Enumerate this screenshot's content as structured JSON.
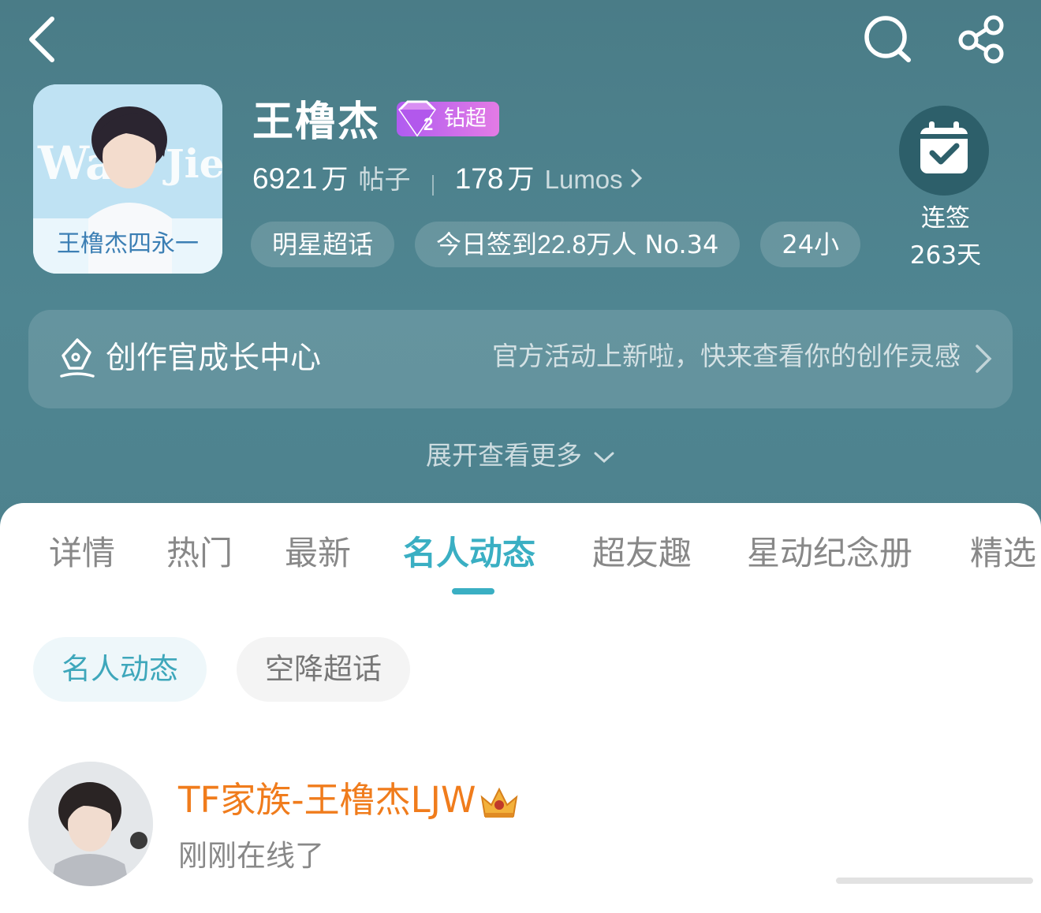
{
  "topic": {
    "name": "王橹杰",
    "badge_label": "钻超",
    "badge_level": "2",
    "avatar_text": "王橹杰四永一",
    "posts_num": "6921",
    "posts_unit": "万",
    "posts_label": "帖子",
    "fans_num": "178",
    "fans_unit": "万",
    "fans_label": "Lumos"
  },
  "tags": [
    {
      "label": "明星超话"
    },
    {
      "label_prefix": "今日签到",
      "label_num": "22.8",
      "label_suffix": "万人 No.34"
    },
    {
      "label": "24小"
    }
  ],
  "checkin": {
    "label": "连签",
    "days": "263天"
  },
  "creator_center": {
    "title": "创作官成长中心",
    "subtitle": "官方活动上新啦，快来查看你的创作灵感"
  },
  "expand_label": "展开查看更多",
  "tabs": [
    "详情",
    "热门",
    "最新",
    "名人动态",
    "超友趣",
    "星动纪念册",
    "精选"
  ],
  "active_tab": "名人动态",
  "subtabs": [
    "名人动态",
    "空降超话"
  ],
  "celebrity": {
    "name": "TF家族-王橹杰LJW",
    "status": "刚刚在线了"
  },
  "colors": {
    "header_bg": "#4d828e",
    "accent": "#3aafc3",
    "celebrity_name": "#f07c1c",
    "badge": "#c36af0"
  },
  "icons": [
    "back-icon",
    "search-icon",
    "share-icon",
    "calendar-check-icon",
    "pen-icon",
    "chevron-right-icon",
    "chevron-down-icon",
    "crown-icon",
    "diamond-icon"
  ]
}
